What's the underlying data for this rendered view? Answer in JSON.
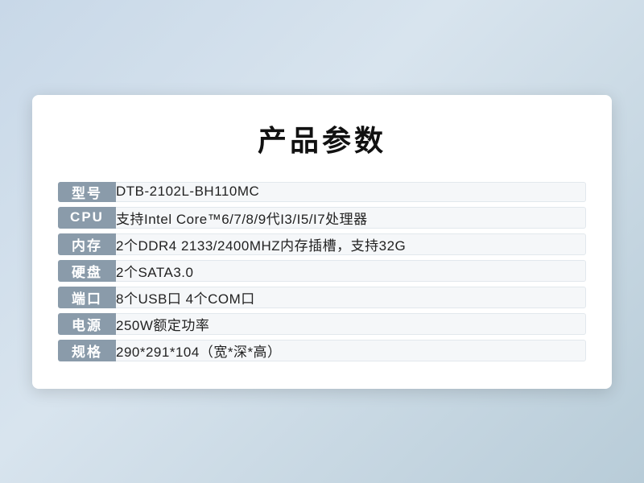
{
  "page": {
    "title": "产品参数",
    "rows": [
      {
        "label": "型号",
        "value": "DTB-2102L-BH110MC"
      },
      {
        "label": "CPU",
        "value": "支持Intel Core™6/7/8/9代I3/I5/I7处理器"
      },
      {
        "label": "内存",
        "value": "2个DDR4 2133/2400MHZ内存插槽，支持32G"
      },
      {
        "label": "硬盘",
        "value": "2个SATA3.0"
      },
      {
        "label": "端口",
        "value": "8个USB口 4个COM口"
      },
      {
        "label": "电源",
        "value": "250W额定功率"
      },
      {
        "label": "规格",
        "value": "290*291*104（宽*深*高）"
      }
    ]
  }
}
